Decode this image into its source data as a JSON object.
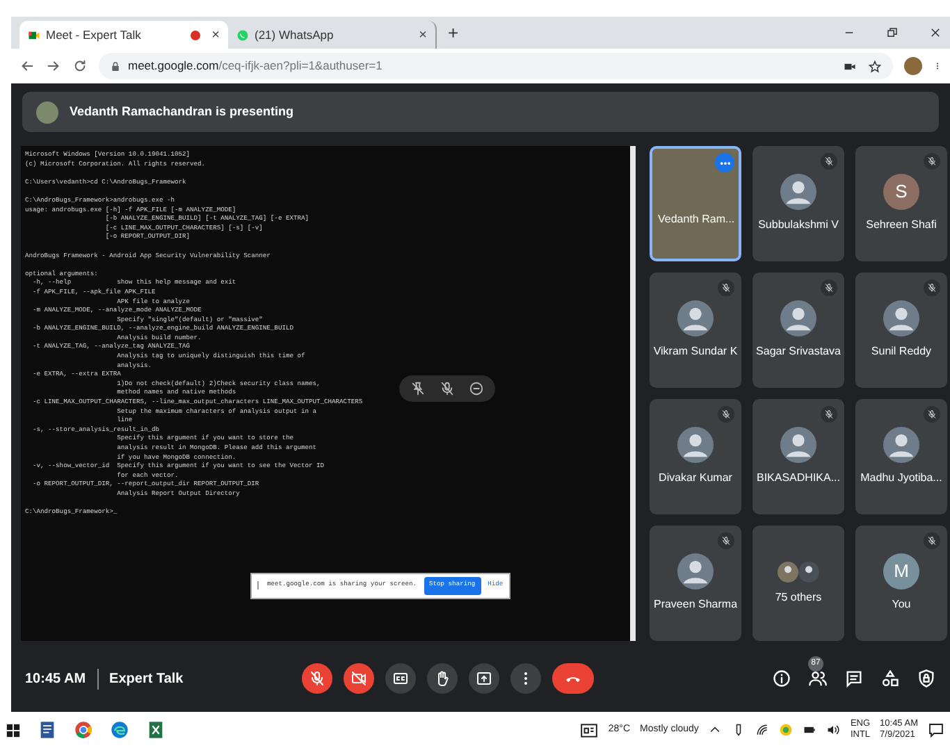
{
  "browser": {
    "tabs": [
      {
        "title": "Meet - Expert Talk",
        "selected": true,
        "recording": true,
        "close": "×"
      },
      {
        "title": "(21) WhatsApp",
        "selected": false,
        "recording": false,
        "close": "×"
      }
    ],
    "new_tab": "+",
    "url_host": "meet.google.com",
    "url_path": "/ceq-ifjk-aen?pli=1&authuser=1"
  },
  "presenting_banner": "Vedanth Ramachandran is presenting",
  "terminal": {
    "blocks": [
      [
        "Microsoft Windows [Version 10.0.19041.1052]",
        "(c) Microsoft Corporation. All rights reserved."
      ],
      [
        "C:\\Users\\vedanth>cd C:\\AndroBugs_Framework"
      ],
      [
        "C:\\AndroBugs_Framework>androbugs.exe -h",
        "usage: androbugs.exe [-h] -f APK_FILE [-m ANALYZE_MODE]",
        "                     [-b ANALYZE_ENGINE_BUILD] [-t ANALYZE_TAG] [-e EXTRA]",
        "                     [-c LINE_MAX_OUTPUT_CHARACTERS] [-s] [-v]",
        "                     [-o REPORT_OUTPUT_DIR]"
      ],
      [
        "AndroBugs Framework - Android App Security Vulnerability Scanner"
      ],
      [
        "optional arguments:",
        "  -h, --help            show this help message and exit",
        "  -f APK_FILE, --apk_file APK_FILE",
        "                        APK file to analyze",
        "  -m ANALYZE_MODE, --analyze_mode ANALYZE_MODE",
        "                        Specify \"single\"(default) or \"massive\"",
        "  -b ANALYZE_ENGINE_BUILD, --analyze_engine_build ANALYZE_ENGINE_BUILD",
        "                        Analysis build number.",
        "  -t ANALYZE_TAG, --analyze_tag ANALYZE_TAG",
        "                        Analysis tag to uniquely distinguish this time of",
        "                        analysis.",
        "  -e EXTRA, --extra EXTRA",
        "                        1)Do not check(default) 2)Check security class names,",
        "                        method names and native methods",
        "  -c LINE_MAX_OUTPUT_CHARACTERS, --line_max_output_characters LINE_MAX_OUTPUT_CHARACTERS",
        "                        Setup the maximum characters of analysis output in a",
        "                        line",
        "  -s, --store_analysis_result_in_db",
        "                        Specify this argument if you want to store the",
        "                        analysis result in MongoDB. Please add this argument",
        "                        if you have MongoDB connection.",
        "  -v, --show_vector_id  Specify this argument if you want to see the Vector ID",
        "                        for each vector.",
        "  -o REPORT_OUTPUT_DIR, --report_output_dir REPORT_OUTPUT_DIR",
        "                        Analysis Report Output Directory"
      ],
      [
        "C:\\AndroBugs_Framework>_"
      ]
    ]
  },
  "sharing_bar": {
    "message": "meet.google.com is sharing your screen.",
    "stop_button": "Stop sharing",
    "hide_link": "Hide"
  },
  "participants": [
    {
      "name": "Vedanth Ram...",
      "kind": "video",
      "muted": false,
      "speaking": true
    },
    {
      "name": "Subbulakshmi V",
      "kind": "photo",
      "muted": true,
      "speaking": false
    },
    {
      "name": "Sehreen Shafi",
      "kind": "letter",
      "initial": "S",
      "color": "#8d6e63",
      "muted": true,
      "speaking": false
    },
    {
      "name": "Vikram Sundar K",
      "kind": "photo",
      "muted": true,
      "speaking": false
    },
    {
      "name": "Sagar Srivastava",
      "kind": "photo",
      "muted": true,
      "speaking": false
    },
    {
      "name": "Sunil Reddy",
      "kind": "photo",
      "muted": true,
      "speaking": false
    },
    {
      "name": "Divakar Kumar",
      "kind": "photo",
      "muted": true,
      "speaking": false
    },
    {
      "name": "BIKASADHIKA...",
      "kind": "photo",
      "muted": true,
      "speaking": false
    },
    {
      "name": "Madhu Jyotiba...",
      "kind": "photo",
      "muted": true,
      "speaking": false
    },
    {
      "name": "Praveen Sharma",
      "kind": "photo",
      "muted": true,
      "speaking": false
    },
    {
      "name": "75 others",
      "kind": "group",
      "muted": false,
      "speaking": false
    },
    {
      "name": "You",
      "kind": "letter",
      "initial": "M",
      "color": "#78909c",
      "muted": true,
      "speaking": false
    }
  ],
  "meeting_bar": {
    "time": "10:45 AM",
    "title": "Expert Talk",
    "mic_on": false,
    "camera_on": false,
    "people_count": "87"
  },
  "taskbar": {
    "weather": "28°C",
    "weather_text": "Mostly cloudy",
    "language": "ENG",
    "layout": "INTL",
    "time": "10:45 AM",
    "date": "7/9/2021"
  }
}
